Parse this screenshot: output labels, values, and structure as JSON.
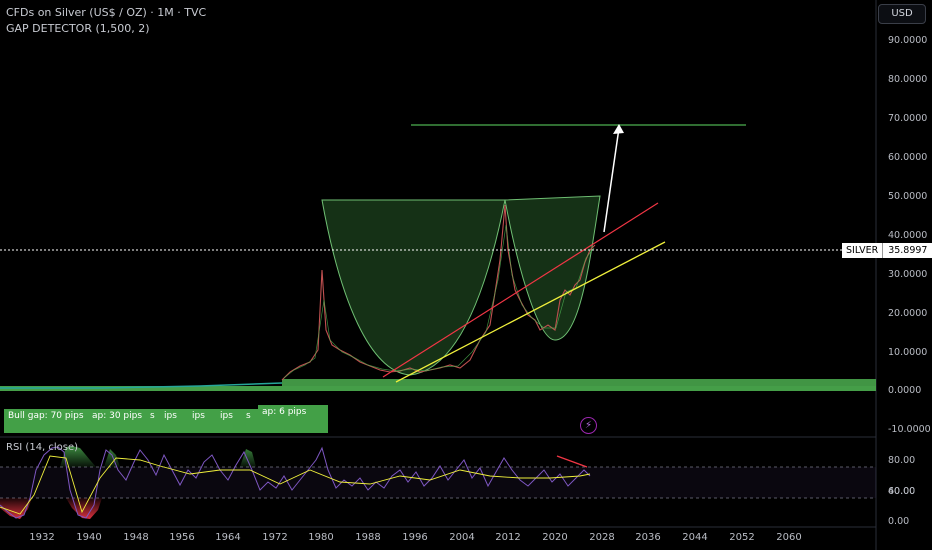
{
  "header": {
    "title": "CFDs on Silver (US$ / OZ) · 1M · TVC",
    "indicator": "GAP DETECTOR (1,500, 2)"
  },
  "currency_button": "USD",
  "price_tag": {
    "symbol": "SILVER",
    "value": "35.8997"
  },
  "price_axis": [
    "90.0000",
    "80.0000",
    "70.0000",
    "60.0000",
    "50.0000",
    "40.0000",
    "30.0000",
    "20.0000",
    "10.0000",
    "0.0000",
    "-10.0000"
  ],
  "rsi_label": "RSI (14, close)",
  "rsi_axis": [
    "80.00",
    "60.00",
    "40.00",
    "0.00"
  ],
  "time_axis": [
    "1932",
    "1940",
    "1948",
    "1956",
    "1964",
    "1972",
    "1980",
    "1988",
    "1996",
    "2004",
    "2012",
    "2020",
    "2028",
    "2036",
    "2044",
    "2052",
    "2060"
  ],
  "gap_labels": [
    {
      "text": "Bull gap: 70 pips"
    },
    {
      "text": "ap: 30 pips"
    },
    {
      "text": "s"
    },
    {
      "text": "ips"
    },
    {
      "text": "ips"
    },
    {
      "text": "ips"
    },
    {
      "text": "s"
    },
    {
      "text": "ap: 6 pips"
    }
  ],
  "colors": {
    "background": "#000000",
    "bull_zone": "#4caf50",
    "red_trend": "#f23645",
    "yellow_trend": "#f0f03c",
    "target_line": "#4caf50",
    "arrow": "#ffffff",
    "rsi_line": "#7e57c2"
  },
  "icons": {
    "flash": "lightning-icon"
  }
}
